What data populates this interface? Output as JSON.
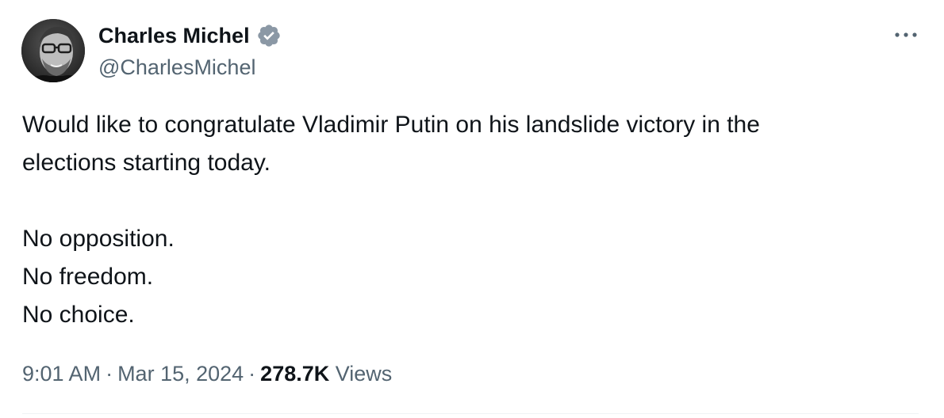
{
  "author": {
    "display_name": "Charles Michel",
    "handle": "@CharlesMichel",
    "verified": true,
    "verified_color": "#8b98a5"
  },
  "tweet": {
    "lines": [
      "Would like to congratulate Vladimir Putin on his landslide victory in the",
      "elections starting today.",
      "",
      "No opposition.",
      "No freedom.",
      "No choice."
    ]
  },
  "meta": {
    "time": "9:01 AM",
    "separator": "·",
    "date": "Mar 15, 2024",
    "views_count": "278.7K",
    "views_label": "Views"
  },
  "icons": {
    "more": "more-horizontal-icon",
    "verified": "verified-badge-icon"
  }
}
